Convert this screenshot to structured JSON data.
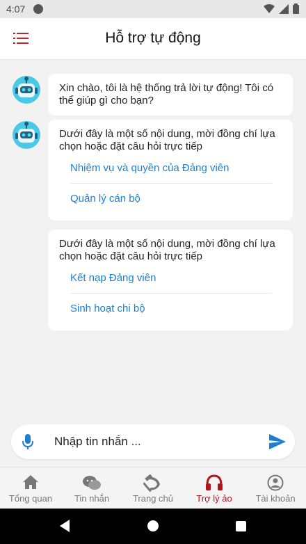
{
  "status": {
    "time": "4:07"
  },
  "header": {
    "title": "Hỗ trợ tự động"
  },
  "messages": [
    {
      "text": "Xin chào, tôi là hệ thống trả lời tự động! Tôi có thể giúp gì cho bạn?"
    },
    {
      "text": "Dưới đây là một số nội dung, mời đồng chí lựa chọn hoặc đặt câu hỏi trực tiếp",
      "options": [
        "Nhiệm vụ và quyền của Đảng viên",
        "Quản lý cán bộ"
      ]
    },
    {
      "text": "Dưới đây là một số nội dung, mời đồng chí lựa chọn hoặc đặt câu hỏi trực tiếp",
      "options": [
        "Kết nạp Đảng viên",
        "Sinh hoạt chi bộ"
      ]
    }
  ],
  "composer": {
    "placeholder": "Nhập tin nhắn ..."
  },
  "tabs": [
    {
      "label": "Tổng quan",
      "icon": "home-icon"
    },
    {
      "label": "Tin nhắn",
      "icon": "chat-icon"
    },
    {
      "label": "Trang chủ",
      "icon": "hammer-sickle-icon"
    },
    {
      "label": "Trợ lý ảo",
      "icon": "headphones-icon",
      "active": true
    },
    {
      "label": "Tài khoản",
      "icon": "account-icon"
    }
  ],
  "colors": {
    "accent": "#b3131b",
    "link": "#1e7fd1",
    "bot": "#49c8e8"
  }
}
